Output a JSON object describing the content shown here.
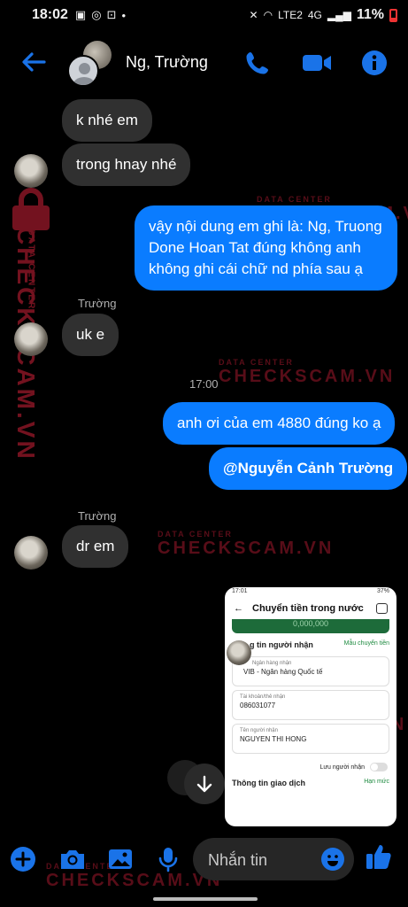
{
  "status": {
    "time": "18:02",
    "battery": "11%",
    "network": "LTE2",
    "signal": "4G"
  },
  "header": {
    "contact_name": "Ng, Trường"
  },
  "messages": [
    {
      "id": "m1",
      "text": "k nhé em"
    },
    {
      "id": "m2",
      "text": "trong hnay nhé"
    },
    {
      "id": "m3",
      "text": "vậy nội dung em ghi là: Ng, Truong Done Hoan Tat đúng không anh không ghi cái chữ nd phía sau ạ"
    },
    {
      "id": "m4",
      "sender": "Trường",
      "text": "uk e"
    },
    {
      "id": "m5",
      "timestamp": "17:00"
    },
    {
      "id": "m6",
      "text": "anh ơi của em 4880 đúng ko ạ"
    },
    {
      "id": "m7",
      "text": "@Nguyễn Cảnh Trường"
    },
    {
      "id": "m8",
      "sender": "Trường",
      "text": "dr em"
    }
  ],
  "shared_image": {
    "status_time": "17:01",
    "status_batt": "37%",
    "title": "Chuyển tiền trong nước",
    "amount_partial": "0,000,000",
    "section_receiver": "g tin người nhận",
    "template_link": "Mẫu chuyển tiền",
    "bank_label": "Ngân hàng nhận",
    "bank_value": "VIB - Ngân hàng Quốc tế",
    "account_label": "Tài khoản/thẻ nhận",
    "account_value": "086031077",
    "name_label": "Tên người nhận",
    "name_value": "NGUYEN THI HONG",
    "save_label": "Lưu người nhận",
    "section_txn": "Thông tin giao dịch",
    "limit_link": "Hạn mức"
  },
  "composer": {
    "placeholder": "Nhắn tin"
  },
  "watermark": {
    "top": "DATA CENTER",
    "main": "CHECKSCAM.VN"
  },
  "colors": {
    "outgoing": "#0a7cff",
    "incoming": "#303030",
    "accent": "#1a73e8",
    "watermark": "#d1213a"
  }
}
